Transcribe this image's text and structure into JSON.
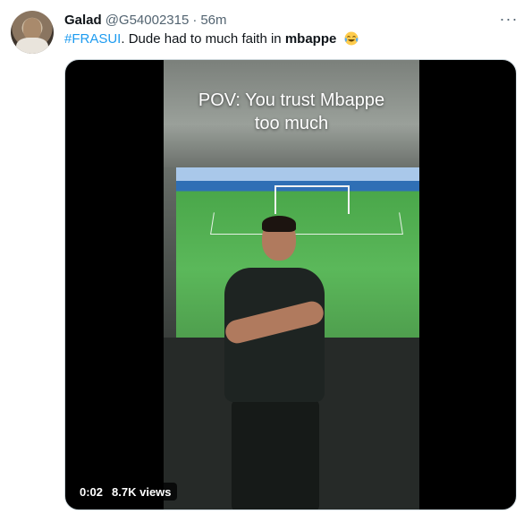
{
  "author": {
    "name": "Galad",
    "handle": "@G54002315",
    "separator": "·",
    "time": "56m"
  },
  "tweet": {
    "hashtag": "#FRASUI",
    "text": ". Dude had to much faith in ",
    "bold_word": "mbappe",
    "emoji": "face-with-tears-of-joy"
  },
  "more_icon": "···",
  "video": {
    "caption_line1": "POV: You trust Mbappe",
    "caption_line2": "too much",
    "duration": "0:02",
    "views": "8.7K views"
  },
  "colors": {
    "link": "#1d9bf0",
    "secondary_text": "#536471",
    "primary_text": "#0f1419"
  }
}
